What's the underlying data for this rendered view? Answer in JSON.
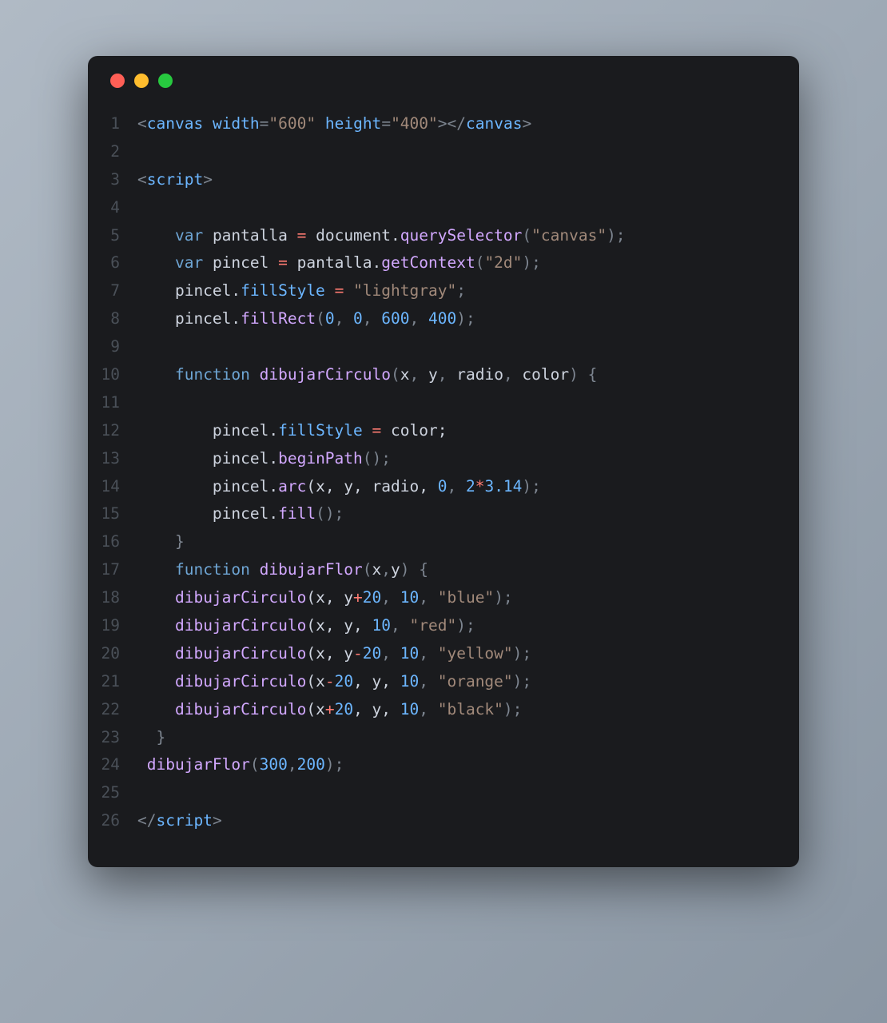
{
  "window": {
    "traffic_lights": [
      "red",
      "yellow",
      "green"
    ]
  },
  "code": {
    "lines": [
      {
        "n": "1",
        "tokens": [
          {
            "t": "<",
            "c": "punct"
          },
          {
            "t": "canvas",
            "c": "tag"
          },
          {
            "t": " ",
            "c": "code"
          },
          {
            "t": "width",
            "c": "attr"
          },
          {
            "t": "=",
            "c": "punct"
          },
          {
            "t": "\"600\"",
            "c": "str"
          },
          {
            "t": " ",
            "c": "code"
          },
          {
            "t": "height",
            "c": "attr"
          },
          {
            "t": "=",
            "c": "punct"
          },
          {
            "t": "\"400\"",
            "c": "str"
          },
          {
            "t": "></",
            "c": "punct"
          },
          {
            "t": "canvas",
            "c": "tag"
          },
          {
            "t": ">",
            "c": "punct"
          }
        ]
      },
      {
        "n": "2",
        "tokens": []
      },
      {
        "n": "3",
        "tokens": [
          {
            "t": "<",
            "c": "punct"
          },
          {
            "t": "script",
            "c": "tag"
          },
          {
            "t": ">",
            "c": "punct"
          }
        ]
      },
      {
        "n": "4",
        "tokens": []
      },
      {
        "n": "5",
        "tokens": [
          {
            "t": "    ",
            "c": "code"
          },
          {
            "t": "var",
            "c": "keyword"
          },
          {
            "t": " pantalla ",
            "c": "varname"
          },
          {
            "t": "=",
            "c": "op"
          },
          {
            "t": " document.",
            "c": "varname"
          },
          {
            "t": "querySelector",
            "c": "method"
          },
          {
            "t": "(",
            "c": "punct"
          },
          {
            "t": "\"canvas\"",
            "c": "str"
          },
          {
            "t": ");",
            "c": "punct"
          }
        ]
      },
      {
        "n": "6",
        "tokens": [
          {
            "t": "    ",
            "c": "code"
          },
          {
            "t": "var",
            "c": "keyword"
          },
          {
            "t": " pincel ",
            "c": "varname"
          },
          {
            "t": "=",
            "c": "op"
          },
          {
            "t": " pantalla.",
            "c": "varname"
          },
          {
            "t": "getContext",
            "c": "method"
          },
          {
            "t": "(",
            "c": "punct"
          },
          {
            "t": "\"2d\"",
            "c": "str"
          },
          {
            "t": ");",
            "c": "punct"
          }
        ]
      },
      {
        "n": "7",
        "tokens": [
          {
            "t": "    pincel.",
            "c": "varname"
          },
          {
            "t": "fillStyle",
            "c": "prop"
          },
          {
            "t": " ",
            "c": "code"
          },
          {
            "t": "=",
            "c": "op"
          },
          {
            "t": " ",
            "c": "code"
          },
          {
            "t": "\"lightgray\"",
            "c": "str"
          },
          {
            "t": ";",
            "c": "punct"
          }
        ]
      },
      {
        "n": "8",
        "tokens": [
          {
            "t": "    pincel.",
            "c": "varname"
          },
          {
            "t": "fillRect",
            "c": "method"
          },
          {
            "t": "(",
            "c": "punct"
          },
          {
            "t": "0",
            "c": "num"
          },
          {
            "t": ", ",
            "c": "punct"
          },
          {
            "t": "0",
            "c": "num"
          },
          {
            "t": ", ",
            "c": "punct"
          },
          {
            "t": "600",
            "c": "num"
          },
          {
            "t": ", ",
            "c": "punct"
          },
          {
            "t": "400",
            "c": "num"
          },
          {
            "t": ");",
            "c": "punct"
          }
        ]
      },
      {
        "n": "9",
        "tokens": []
      },
      {
        "n": "10",
        "tokens": [
          {
            "t": "    ",
            "c": "code"
          },
          {
            "t": "function",
            "c": "keyword"
          },
          {
            "t": " ",
            "c": "code"
          },
          {
            "t": "dibujarCirculo",
            "c": "funcname"
          },
          {
            "t": "(",
            "c": "punct"
          },
          {
            "t": "x",
            "c": "param"
          },
          {
            "t": ", ",
            "c": "punct"
          },
          {
            "t": "y",
            "c": "param"
          },
          {
            "t": ", ",
            "c": "punct"
          },
          {
            "t": "radio",
            "c": "param"
          },
          {
            "t": ", ",
            "c": "punct"
          },
          {
            "t": "color",
            "c": "param"
          },
          {
            "t": ") {",
            "c": "punct"
          }
        ]
      },
      {
        "n": "11",
        "tokens": []
      },
      {
        "n": "12",
        "tokens": [
          {
            "t": "        pincel.",
            "c": "varname"
          },
          {
            "t": "fillStyle",
            "c": "prop"
          },
          {
            "t": " ",
            "c": "code"
          },
          {
            "t": "=",
            "c": "op"
          },
          {
            "t": " color;",
            "c": "varname"
          }
        ]
      },
      {
        "n": "13",
        "tokens": [
          {
            "t": "        pincel.",
            "c": "varname"
          },
          {
            "t": "beginPath",
            "c": "method"
          },
          {
            "t": "();",
            "c": "punct"
          }
        ]
      },
      {
        "n": "14",
        "tokens": [
          {
            "t": "        pincel.",
            "c": "varname"
          },
          {
            "t": "arc",
            "c": "method"
          },
          {
            "t": "(x, y, radio, ",
            "c": "varname"
          },
          {
            "t": "0",
            "c": "num"
          },
          {
            "t": ", ",
            "c": "punct"
          },
          {
            "t": "2",
            "c": "num"
          },
          {
            "t": "*",
            "c": "op"
          },
          {
            "t": "3.14",
            "c": "num"
          },
          {
            "t": ");",
            "c": "punct"
          }
        ]
      },
      {
        "n": "15",
        "tokens": [
          {
            "t": "        pincel.",
            "c": "varname"
          },
          {
            "t": "fill",
            "c": "method"
          },
          {
            "t": "();",
            "c": "punct"
          }
        ]
      },
      {
        "n": "16",
        "tokens": [
          {
            "t": "    }",
            "c": "punct"
          }
        ]
      },
      {
        "n": "17",
        "tokens": [
          {
            "t": "    ",
            "c": "code"
          },
          {
            "t": "function",
            "c": "keyword"
          },
          {
            "t": " ",
            "c": "code"
          },
          {
            "t": "dibujarFlor",
            "c": "funcname"
          },
          {
            "t": "(",
            "c": "punct"
          },
          {
            "t": "x",
            "c": "param"
          },
          {
            "t": ",",
            "c": "punct"
          },
          {
            "t": "y",
            "c": "param"
          },
          {
            "t": ") {",
            "c": "punct"
          }
        ]
      },
      {
        "n": "18",
        "tokens": [
          {
            "t": "    ",
            "c": "code"
          },
          {
            "t": "dibujarCirculo",
            "c": "method"
          },
          {
            "t": "(x, y",
            "c": "varname"
          },
          {
            "t": "+",
            "c": "op"
          },
          {
            "t": "20",
            "c": "num"
          },
          {
            "t": ", ",
            "c": "punct"
          },
          {
            "t": "10",
            "c": "num"
          },
          {
            "t": ", ",
            "c": "punct"
          },
          {
            "t": "\"blue\"",
            "c": "str"
          },
          {
            "t": ");",
            "c": "punct"
          }
        ]
      },
      {
        "n": "19",
        "tokens": [
          {
            "t": "    ",
            "c": "code"
          },
          {
            "t": "dibujarCirculo",
            "c": "method"
          },
          {
            "t": "(x, y, ",
            "c": "varname"
          },
          {
            "t": "10",
            "c": "num"
          },
          {
            "t": ", ",
            "c": "punct"
          },
          {
            "t": "\"red\"",
            "c": "str"
          },
          {
            "t": ");",
            "c": "punct"
          }
        ]
      },
      {
        "n": "20",
        "tokens": [
          {
            "t": "    ",
            "c": "code"
          },
          {
            "t": "dibujarCirculo",
            "c": "method"
          },
          {
            "t": "(x, y",
            "c": "varname"
          },
          {
            "t": "-",
            "c": "op"
          },
          {
            "t": "20",
            "c": "num"
          },
          {
            "t": ", ",
            "c": "punct"
          },
          {
            "t": "10",
            "c": "num"
          },
          {
            "t": ", ",
            "c": "punct"
          },
          {
            "t": "\"yellow\"",
            "c": "str"
          },
          {
            "t": ");",
            "c": "punct"
          }
        ]
      },
      {
        "n": "21",
        "tokens": [
          {
            "t": "    ",
            "c": "code"
          },
          {
            "t": "dibujarCirculo",
            "c": "method"
          },
          {
            "t": "(x",
            "c": "varname"
          },
          {
            "t": "-",
            "c": "op"
          },
          {
            "t": "20",
            "c": "num"
          },
          {
            "t": ", y, ",
            "c": "varname"
          },
          {
            "t": "10",
            "c": "num"
          },
          {
            "t": ", ",
            "c": "punct"
          },
          {
            "t": "\"orange\"",
            "c": "str"
          },
          {
            "t": ");",
            "c": "punct"
          }
        ]
      },
      {
        "n": "22",
        "tokens": [
          {
            "t": "    ",
            "c": "code"
          },
          {
            "t": "dibujarCirculo",
            "c": "method"
          },
          {
            "t": "(x",
            "c": "varname"
          },
          {
            "t": "+",
            "c": "op"
          },
          {
            "t": "20",
            "c": "num"
          },
          {
            "t": ", y, ",
            "c": "varname"
          },
          {
            "t": "10",
            "c": "num"
          },
          {
            "t": ", ",
            "c": "punct"
          },
          {
            "t": "\"black\"",
            "c": "str"
          },
          {
            "t": ");",
            "c": "punct"
          }
        ]
      },
      {
        "n": "23",
        "tokens": [
          {
            "t": "  }",
            "c": "punct"
          }
        ]
      },
      {
        "n": "24",
        "tokens": [
          {
            "t": " ",
            "c": "code"
          },
          {
            "t": "dibujarFlor",
            "c": "method"
          },
          {
            "t": "(",
            "c": "punct"
          },
          {
            "t": "300",
            "c": "num"
          },
          {
            "t": ",",
            "c": "punct"
          },
          {
            "t": "200",
            "c": "num"
          },
          {
            "t": ");",
            "c": "punct"
          }
        ]
      },
      {
        "n": "25",
        "tokens": []
      },
      {
        "n": "26",
        "tokens": [
          {
            "t": "</",
            "c": "punct"
          },
          {
            "t": "script",
            "c": "tag"
          },
          {
            "t": ">",
            "c": "punct"
          }
        ]
      }
    ]
  }
}
